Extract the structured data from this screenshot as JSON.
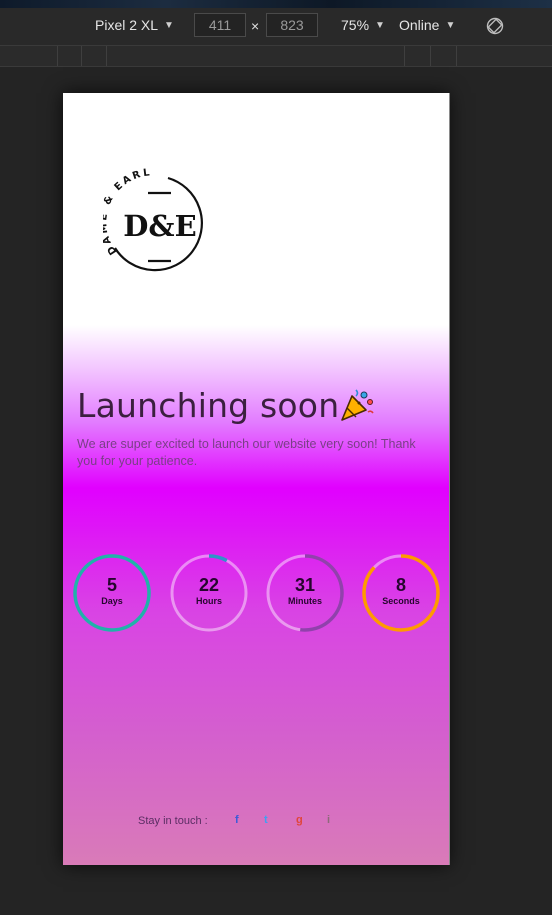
{
  "devtools": {
    "device": "Pixel 2 XL",
    "width": "411",
    "height": "823",
    "times": "×",
    "zoom": "75%",
    "network": "Online",
    "icons": {
      "rotate": "rotate-icon",
      "caret": "▼"
    }
  },
  "page": {
    "logo": {
      "arc_text": "DAME & EARL",
      "monogram": "D&E"
    },
    "title": "Launching soon",
    "subtitle": "We are super excited to launch our website very soon! Thank you for your patience.",
    "countdown": [
      {
        "value": "5",
        "label": "Days",
        "color": "#20b2aa",
        "progress": 1.0
      },
      {
        "value": "22",
        "label": "Hours",
        "color": "#2f93c8",
        "progress": 0.08
      },
      {
        "value": "31",
        "label": "Minutes",
        "color": "#9141ac",
        "progress": 0.52
      },
      {
        "value": "8",
        "label": "Seconds",
        "color": "#ff9a00",
        "progress": 0.87
      }
    ],
    "social": {
      "label": "Stay in touch :",
      "links": [
        {
          "glyph": "f",
          "name": "facebook",
          "color": "#3b5bd6"
        },
        {
          "glyph": "t",
          "name": "twitter",
          "color": "#3ea1f2"
        },
        {
          "glyph": "g",
          "name": "google-plus",
          "color": "#e0453a"
        },
        {
          "glyph": "i",
          "name": "instagram",
          "color": "#8e6a7a"
        }
      ]
    }
  }
}
